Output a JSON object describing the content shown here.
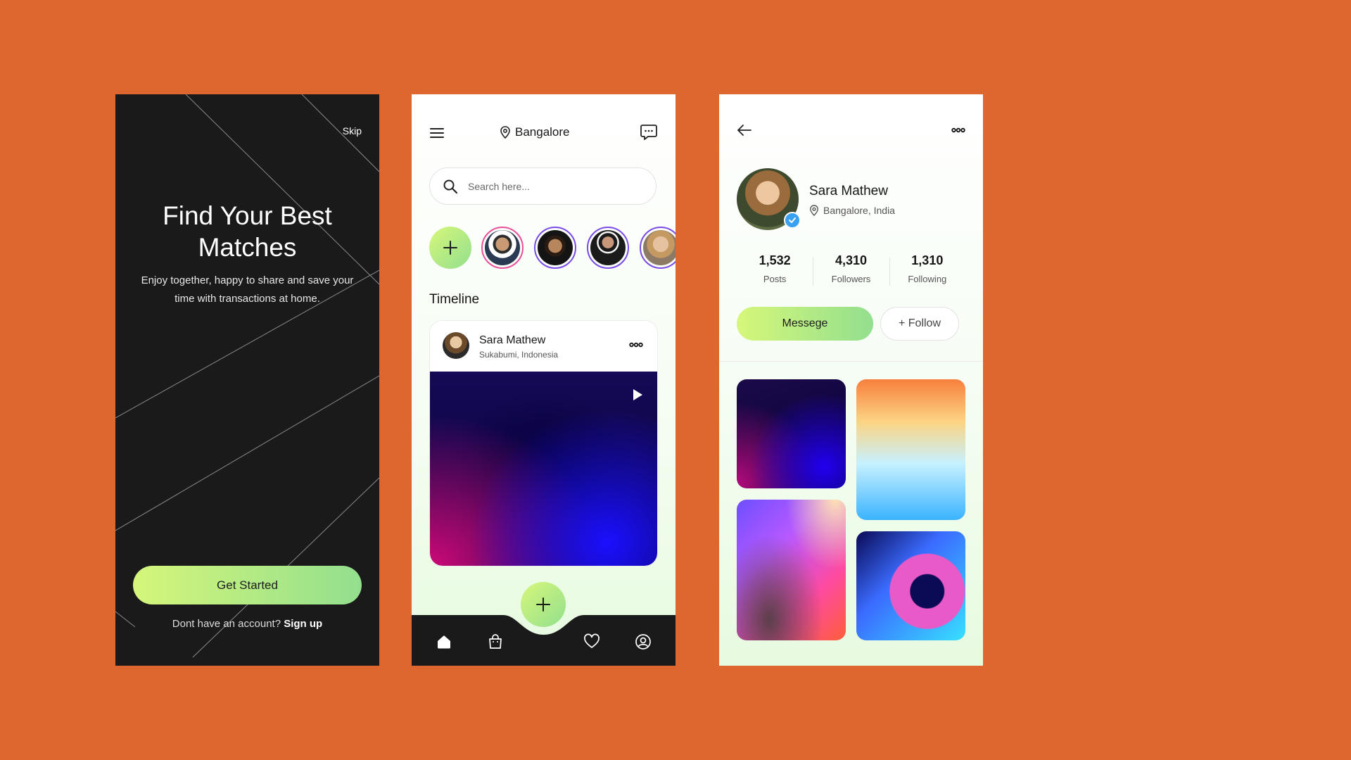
{
  "colors": {
    "background": "#dd672e",
    "accent_gradient_start": "#d5f67a",
    "accent_gradient_end": "#93df8e",
    "dark": "#1a1a1a",
    "verified": "#3aa0f0"
  },
  "onboarding": {
    "skip_label": "Skip",
    "title": "Find Your Best Matches",
    "subtitle": "Enjoy together, happy to share and save your time with transactions at home.",
    "cta_label": "Get Started",
    "signup_prompt": "Dont have an account?",
    "signup_link": "Sign up"
  },
  "home": {
    "location": "Bangalore",
    "search_placeholder": "Search here...",
    "icons": [
      "menu-icon",
      "location-pin-icon",
      "chat-icon",
      "search-icon",
      "plus-icon",
      "play-icon"
    ],
    "stories": [
      {
        "name": "add-story"
      },
      {
        "name": "story-user-1"
      },
      {
        "name": "story-user-2"
      },
      {
        "name": "story-user-3"
      },
      {
        "name": "story-user-4"
      }
    ],
    "section_title": "Timeline",
    "post": {
      "author": "Sara Mathew",
      "location": "Sukabumi, Indonesia"
    },
    "tabs": [
      "home-icon",
      "bag-icon",
      "heart-icon",
      "profile-icon"
    ]
  },
  "profile": {
    "name": "Sara Mathew",
    "location": "Bangalore, India",
    "stats": [
      {
        "value": "1,532",
        "label": "Posts"
      },
      {
        "value": "4,310",
        "label": "Followers"
      },
      {
        "value": "1,310",
        "label": "Following"
      }
    ],
    "message_label": "Messege",
    "follow_label": "+ Follow",
    "icons": [
      "back-arrow-icon",
      "more-icon",
      "verified-icon",
      "location-pin-icon"
    ]
  }
}
